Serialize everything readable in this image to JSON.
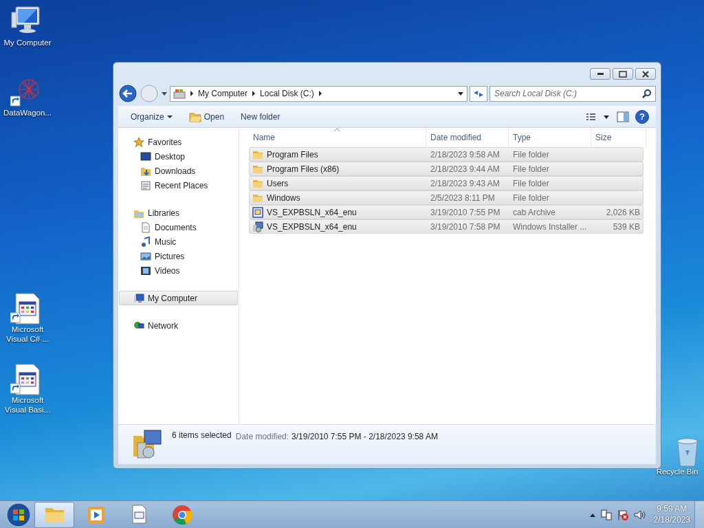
{
  "desktop_icons": [
    {
      "label": "My Computer",
      "kind": "computer",
      "shortcut": false
    },
    {
      "label": "DataWagon...",
      "kind": "starburst",
      "shortcut": true
    },
    {
      "label": "Microsoft Visual C# ...",
      "kind": "appdoc",
      "shortcut": true
    },
    {
      "label": "Microsoft Visual Basi...",
      "kind": "appdoc",
      "shortcut": true
    },
    {
      "label": "Recycle Bin",
      "kind": "recycle",
      "shortcut": false
    }
  ],
  "window": {
    "address": [
      "My Computer",
      "Local Disk (C:)"
    ],
    "search": {
      "placeholder": "Search Local Disk (C:)"
    },
    "toolbar": [
      {
        "label": "Organize",
        "kind": "menu"
      },
      {
        "label": "Open",
        "kind": "open"
      },
      {
        "label": "New folder",
        "kind": "plain"
      }
    ],
    "nav_pane": [
      {
        "label": "Favorites",
        "selected": false,
        "children": [
          {
            "label": "Desktop",
            "selected": false
          },
          {
            "label": "Downloads",
            "selected": false
          },
          {
            "label": "Recent Places",
            "selected": false
          }
        ]
      },
      {
        "label": "Libraries",
        "selected": false,
        "children": [
          {
            "label": "Documents",
            "selected": false
          },
          {
            "label": "Music",
            "selected": false
          },
          {
            "label": "Pictures",
            "selected": false
          },
          {
            "label": "Videos",
            "selected": false
          }
        ]
      },
      {
        "label": "My Computer",
        "selected": true
      },
      {
        "label": "Network",
        "selected": false
      }
    ],
    "help": "?",
    "columns": [
      "Name",
      "Date modified",
      "Type",
      "Size"
    ],
    "rows": [
      {
        "kind": "folder",
        "name": "Program Files",
        "date": "2/18/2023 9:58 AM",
        "type": "File folder",
        "selected": true
      },
      {
        "kind": "folder",
        "name": "Program Files (x86)",
        "date": "2/18/2023 9:44 AM",
        "type": "File folder",
        "selected": true
      },
      {
        "kind": "folder",
        "name": "Users",
        "date": "2/18/2023 9:43 AM",
        "type": "File folder",
        "selected": true
      },
      {
        "kind": "folder",
        "name": "Windows",
        "date": "2/5/2023 8:11 PM",
        "type": "File folder",
        "selected": true
      },
      {
        "kind": "cab",
        "name": "VS_EXPBSLN_x64_enu",
        "date": "3/19/2010 7:55 PM",
        "type": "cab Archive",
        "size": "2,026 KB",
        "selected": true
      },
      {
        "kind": "installer",
        "name": "VS_EXPBSLN_x64_enu",
        "date": "3/19/2010 7:58 PM",
        "type": "Windows Installer ...",
        "size": "539 KB",
        "selected": true
      }
    ],
    "details": {
      "count": "6 items selected",
      "label": "Date modified:",
      "value": "3/19/2010 7:55 PM - 2/18/2023 9:58 AM"
    }
  },
  "taskbar": {
    "items": [
      {
        "kind": "explorer",
        "active": true
      },
      {
        "kind": "media",
        "active": false
      },
      {
        "kind": "appdoc",
        "active": false
      },
      {
        "kind": "chrome",
        "active": false
      }
    ],
    "time": "9:59 AM",
    "date": "2/18/2023"
  }
}
